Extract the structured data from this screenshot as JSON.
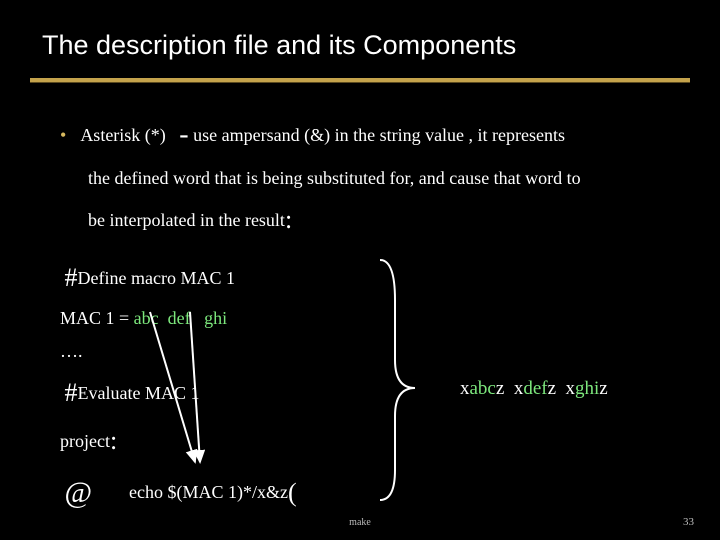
{
  "title": "The description file and its Components",
  "bullet": {
    "lead": "Asterisk (*)",
    "dash": "-",
    "rest1": "use ampersand (&)  in the string value , it represents",
    "line2": "the defined word that is being substituted for, and cause that word to",
    "line3": "be interpolated in the result",
    "colon": ":"
  },
  "code": {
    "define_hash": "#",
    "define_rest": "Define macro MAC 1",
    "assign_pre": "MAC 1 =  ",
    "tok1": "abc",
    "tok2": "def",
    "tok3": "ghi",
    "dots": "….",
    "eval_hash": "#",
    "eval_rest": "Evaluate MAC 1",
    "project": "project",
    "project_colon": ":",
    "at": "@",
    "echo": "echo $(MAC 1)*/x&z",
    "echo_paren": "("
  },
  "result": {
    "r1_x": "x",
    "r1_g": "abc",
    "r1_z": "z",
    "r2_x": "x",
    "r2_g": "def",
    "r2_z": "z",
    "r3_x": "x",
    "r3_g": "ghi",
    "r3_z": "z"
  },
  "footer": {
    "center": "make",
    "page": "33"
  }
}
